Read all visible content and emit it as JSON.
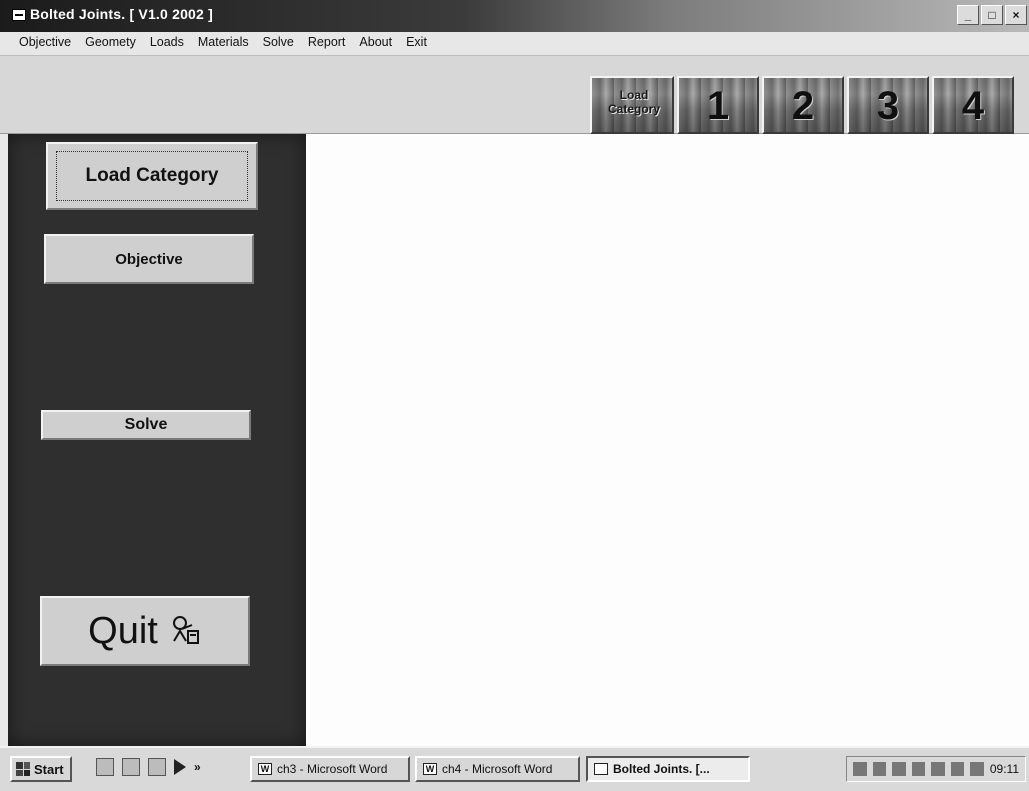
{
  "window": {
    "title": "Bolted Joints.  [ V1.0 2002 ]",
    "controls": [
      "_",
      "□",
      "×"
    ]
  },
  "menu": {
    "items": [
      "Objective",
      "Geomety",
      "Loads",
      "Materials",
      "Solve",
      "Report",
      "About",
      "Exit"
    ]
  },
  "toolbar": {
    "buttons": [
      {
        "label": "Load Category"
      },
      {
        "label": "1"
      },
      {
        "label": "2"
      },
      {
        "label": "3"
      },
      {
        "label": "4"
      }
    ]
  },
  "left_panel": {
    "load_category": "Load Category",
    "objective": "Objective",
    "solve": "Solve",
    "quit": "Quit"
  },
  "taskbar": {
    "start": "Start",
    "tasks": [
      {
        "label": "ch3 - Microsoft Word"
      },
      {
        "label": "ch4 - Microsoft Word"
      },
      {
        "label": "Bolted Joints.  [..."
      }
    ],
    "time": "09:11"
  }
}
